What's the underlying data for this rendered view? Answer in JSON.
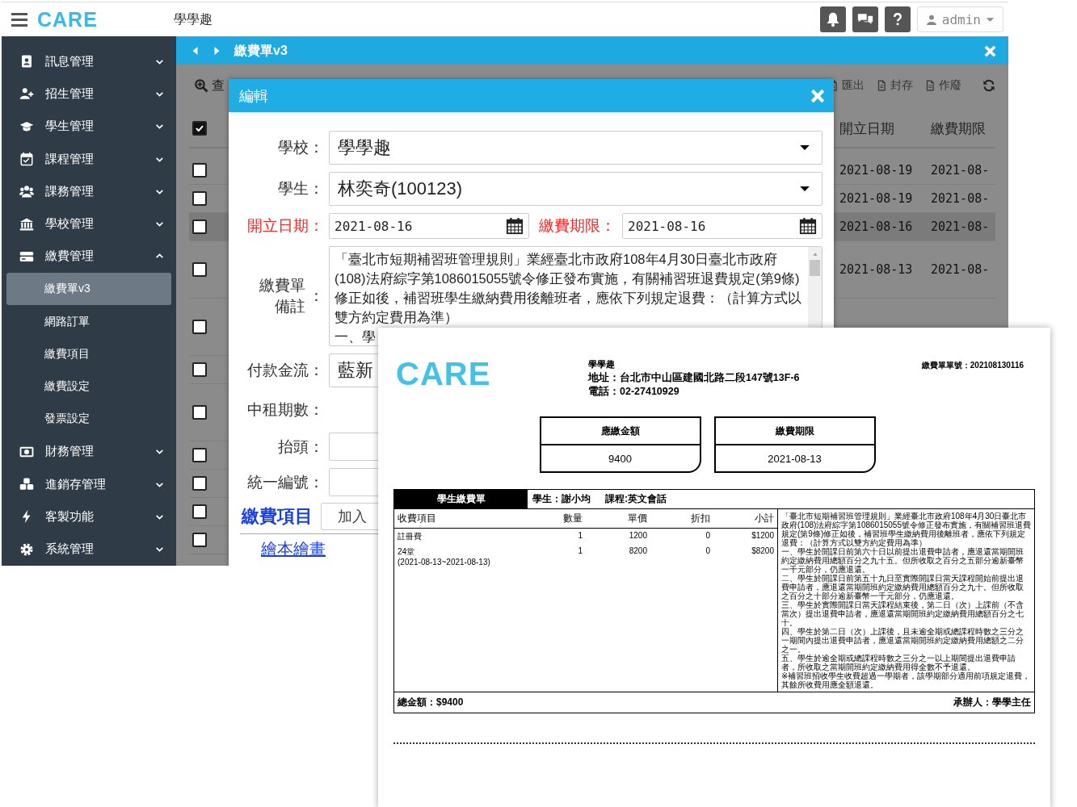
{
  "topbar": {
    "logo": "CARE",
    "school": "學學趣",
    "user": "admin"
  },
  "sidebar": {
    "items": [
      {
        "label": "訊息管理",
        "expanded": false
      },
      {
        "label": "招生管理",
        "expanded": false
      },
      {
        "label": "學生管理",
        "expanded": false
      },
      {
        "label": "課程管理",
        "expanded": false
      },
      {
        "label": "課務管理",
        "expanded": false
      },
      {
        "label": "學校管理",
        "expanded": false
      },
      {
        "label": "繳費管理",
        "expanded": true,
        "children": [
          {
            "label": "繳費單v3",
            "selected": true
          },
          {
            "label": "網路訂單",
            "selected": false
          },
          {
            "label": "繳費項目",
            "selected": false
          },
          {
            "label": "繳費設定",
            "selected": false
          },
          {
            "label": "發票設定",
            "selected": false
          }
        ]
      },
      {
        "label": "財務管理",
        "expanded": false
      },
      {
        "label": "進銷存管理",
        "expanded": false
      },
      {
        "label": "客製功能",
        "expanded": false
      },
      {
        "label": "系統管理",
        "expanded": false
      }
    ]
  },
  "tab": {
    "title": "繳費單v3"
  },
  "toolbar": {
    "search": "查",
    "actions": [
      "匯出",
      "封存",
      "作廢"
    ]
  },
  "table": {
    "columns": [
      "開立日期",
      "繳費期限"
    ],
    "all_checked": true,
    "rows": [
      {
        "checked": false,
        "selected": false,
        "issue_date": "2021-08-19",
        "due_date": "2021-08-"
      },
      {
        "checked": false,
        "selected": false,
        "issue_date": "2021-08-19",
        "due_date": "2021-08-"
      },
      {
        "checked": false,
        "selected": true,
        "issue_date": "2021-08-16",
        "due_date": "2021-08-"
      },
      {
        "checked": false,
        "selected": false,
        "issue_date": "2021-08-13",
        "due_date": "2021-08-"
      },
      {
        "checked": false,
        "selected": false
      },
      {
        "checked": false,
        "selected": false
      },
      {
        "checked": false,
        "selected": false
      },
      {
        "checked": false,
        "selected": false
      },
      {
        "checked": false,
        "selected": false
      },
      {
        "checked": false,
        "selected": false
      },
      {
        "checked": false,
        "selected": false
      }
    ]
  },
  "modal": {
    "title": "編輯",
    "school": {
      "label": "學校：",
      "value": "學學趣",
      "required": false
    },
    "student": {
      "label": "學生：",
      "value": "林奕奇(100123)",
      "required": false
    },
    "issue_date": {
      "label": "開立日期：",
      "value": "2021-08-16",
      "required": true
    },
    "due_date": {
      "label": "繳費期限：",
      "value": "2021-08-16",
      "required": true
    },
    "memo": {
      "label": "繳費單備註",
      "colon": "：",
      "lines": [
        "「臺北市短期補習班管理規則」業經臺北市政府108年4月30日臺北市政府(108)法府綜字第1086015055號令修正發布實施，有關補習班退費規定(第9條)修正如後，補習班學生繳納費用後離班者，應依下列規定退費：（計算方式以雙方約定費用為準）",
        "一、學"
      ]
    },
    "payment": {
      "label": "付款金流：",
      "value": "藍新",
      "required": false
    },
    "installments": {
      "label": "中租期數：",
      "required": false
    },
    "invoice_title": {
      "label": "抬頭：",
      "required": false
    },
    "tax_id": {
      "label": "統一編號：",
      "required": false
    },
    "items_heading": "繳費項目",
    "add_button": "加入",
    "item_link": "繪本繪畫"
  },
  "receipt": {
    "logo": "CARE",
    "school": "學學趣",
    "address": "地址：台北市中山區建國北路二段147號13F-6",
    "phone": "電話：02-27410929",
    "number": "繳費單單號：202108130116",
    "boxes": [
      {
        "label": "應繳金額",
        "value": "9400"
      },
      {
        "label": "繳費期限",
        "value": "2021-08-13"
      }
    ],
    "title": "學生繳費單",
    "student": "學生：謝小均",
    "course": "課程:英文會話",
    "columns": [
      "收費項目",
      "數量",
      "單價",
      "折扣",
      "小計"
    ],
    "items": [
      {
        "name": "註冊費",
        "quantity": "1",
        "price": "1200",
        "discount": "0",
        "subtotal": "$1200"
      },
      {
        "name": "24堂",
        "period": "(2021-08-13~2021-08-13)",
        "quantity": "1",
        "price": "8200",
        "discount": "0",
        "subtotal": "$8200"
      }
    ],
    "terms": [
      "「臺北市短期補習班管理規則」業經臺北市政府108年4月30日臺北市政府(108)法府綜字第1086015055號令修正發布實施，有關補習班退費規定(第9條)修正如後，補習班學生繳納費用後離班者，應依下列規定退費：（計算方式以雙方約定費用為準）",
      "一、學生於開課日前第六十日以前提出退費申請者，應退還當期開班約定繳納費用總額百分之九十五。但所收取之百分之五部分逾新臺幣一千元部分，仍應退還。",
      "二、學生於開課日前第五十九日至實際開課日當天課程開始前提出退費申請者，應退還當期開班約定繳納費用總額百分之九十。但所收取之百分之十部分逾新臺幣一千元部分，仍應退還。",
      "三、學生於實際開課日當天課程結束後，第二日（次）上課前（不含當次）提出退費申請者，應退還當期開班約定繳納費用總額百分之七十。",
      "四、學生於第二日（次）上課後，且未逾全期或總課程時數之三分之一期間內提出退費申請者，應退還當期開班約定繳納費用總額之二分之一。",
      "五、學生於逾全期或總課程時數之三分之一以上期間提出退費申請者，所收取之當期開班約定繳納費用得全數不予退還。",
      "※補習班招收學生收費超過一學期者，該學期部分適用前項規定退費，其餘所收費用應全額退還。"
    ],
    "total": "總金額：$9400",
    "handler": "承辦人：學學主任"
  }
}
